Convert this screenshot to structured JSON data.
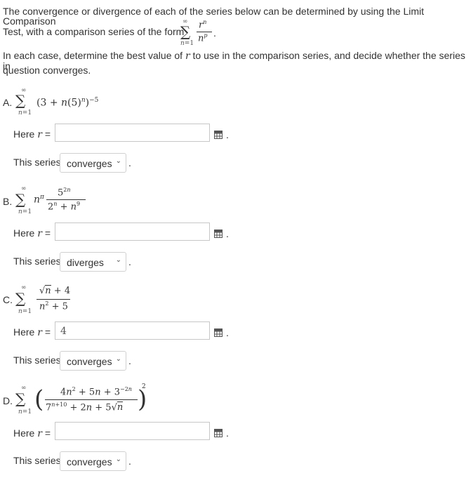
{
  "intro": {
    "line1": "The convergence or divergence of each of the series below can be determined by using the Limit Comparison",
    "line2a": "Test, with a comparison series of the form",
    "line3": "In each case, determine the best value of",
    "line3b": "to use in the comparison series, and decide whether the series in",
    "line4": "question converges."
  },
  "labels": {
    "here_r": "Here",
    "equals": "=",
    "this_series": "This series"
  },
  "parts": [
    {
      "letter": "A.",
      "r_value": "",
      "status": "converges"
    },
    {
      "letter": "B.",
      "r_value": "",
      "status": "diverges"
    },
    {
      "letter": "C.",
      "r_value": "4",
      "status": "converges"
    },
    {
      "letter": "D.",
      "r_value": "",
      "status": "converges"
    }
  ],
  "icons": {
    "palette": "grid-palette-icon",
    "dropdown": "chevron-down-icon"
  },
  "colors": {
    "text": "#333333",
    "input_border": "#c7c7c7",
    "select_border": "#d0d0d0"
  }
}
